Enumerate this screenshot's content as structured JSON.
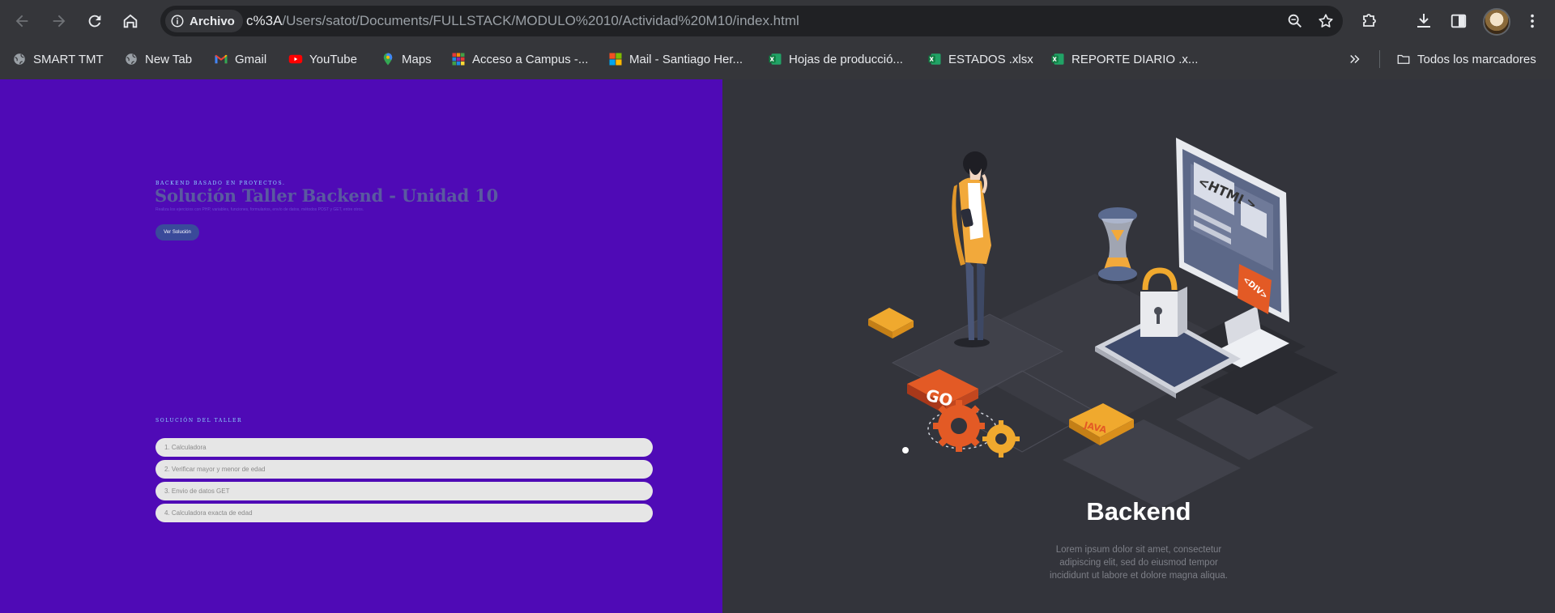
{
  "browser": {
    "site_chip_label": "Archivo",
    "url_host": "c%3A",
    "url_path": "/Users/satot/Documents/FULLSTACK/MODULO%2010/Actividad%20M10/index.html",
    "icons": [
      "back-icon",
      "forward-icon",
      "reload-icon",
      "home-icon",
      "info-icon",
      "zoom-icon",
      "star-icon",
      "extensions-icon",
      "download-icon",
      "side-panel-icon",
      "avatar",
      "more-menu-icon"
    ]
  },
  "bookmarks": {
    "items": [
      {
        "label": "SMART TMT",
        "icon": "globe-icon"
      },
      {
        "label": "New Tab",
        "icon": "globe-icon"
      },
      {
        "label": "Gmail",
        "icon": "gmail-icon"
      },
      {
        "label": "YouTube",
        "icon": "youtube-icon"
      },
      {
        "label": "Maps",
        "icon": "maps-icon"
      },
      {
        "label": "Acceso a Campus -...",
        "icon": "grid-logo-icon"
      },
      {
        "label": "Mail - Santiago Her...",
        "icon": "microsoft-icon"
      },
      {
        "label": "Hojas de producció...",
        "icon": "excel-icon"
      },
      {
        "label": "ESTADOS .xlsx",
        "icon": "excel-icon"
      },
      {
        "label": "REPORTE DIARIO .x...",
        "icon": "excel-icon"
      }
    ],
    "overflow_icon": "chevron-double-right-icon",
    "all_bookmarks_label": "Todos los marcadores"
  },
  "hero": {
    "eyebrow": "BACKEND BASADO EN PROYECTOS.",
    "title": "Solución Taller Backend - Unidad 10",
    "description": "Realiza los ejercicios con PHP, variables, funciones, formularios, envío de datos, métodos POST y GET, entre otros.",
    "button_label": "Ver Solución"
  },
  "solutions": {
    "label": "SOLUCIÓN DEL TALLER",
    "items": [
      "1. Calculadora",
      "2. Verificar mayor y menor de edad",
      "3. Envio de datos GET",
      "4. Calculadora exacta de edad"
    ]
  },
  "illustration": {
    "screen_text": "<HTML>",
    "div_tag": "<DIV>",
    "go_label": "GO",
    "java_label": "JAVA",
    "title": "Backend",
    "description": "Lorem ipsum dolor sit amet, consectetur adipiscing elit, sed do eiusmod tempor incididunt ut labore et dolore magna aliqua."
  },
  "colors": {
    "left_bg": "#4f0ab6",
    "right_bg": "#33343b",
    "button": "#3a4a9a",
    "accent_orange": "#e35a25",
    "accent_yellow": "#f0a92e"
  }
}
